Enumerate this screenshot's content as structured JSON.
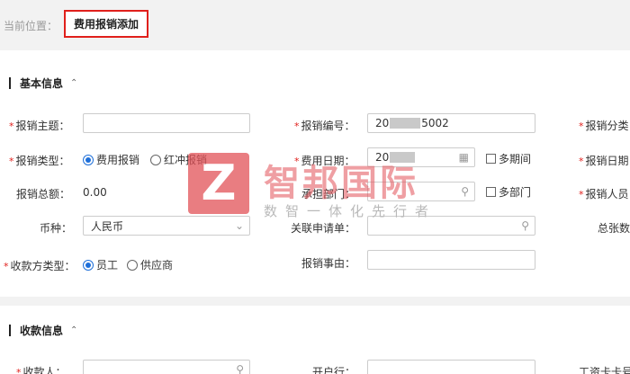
{
  "breadcrumb": {
    "label": "当前位置：",
    "current": "费用报销添加"
  },
  "basic": {
    "title": "基本信息",
    "fields": {
      "subject_label": "报销主题：",
      "number_label": "报销编号：",
      "number_prefix": "20",
      "number_suffix": "5002",
      "category_label": "报销分类",
      "type_label": "报销类型：",
      "type_options": [
        "费用报销",
        "红冲报销"
      ],
      "date_label": "费用日期：",
      "date_prefix": "20",
      "multi_period_label": "多期间",
      "reimb_date_label": "报销日期",
      "total_label": "报销总额：",
      "total_value": "0.00",
      "dept_label": "承担部门：",
      "multi_dept_label": "多部门",
      "person_label": "报销人员",
      "currency_label": "币种：",
      "currency_value": "人民币",
      "related_label": "关联申请单：",
      "pages_label": "总张数",
      "payee_type_label": "收款方类型：",
      "payee_type_options": [
        "员工",
        "供应商"
      ],
      "reason_label": "报销事由："
    }
  },
  "payee": {
    "title": "收款信息",
    "payee_label": "收款人：",
    "bank_label": "开户行：",
    "card_label": "工资卡卡号"
  },
  "watermark": {
    "logo_letter": "Z",
    "name": "智邦国际",
    "slogan": "数智一体化先行者"
  }
}
